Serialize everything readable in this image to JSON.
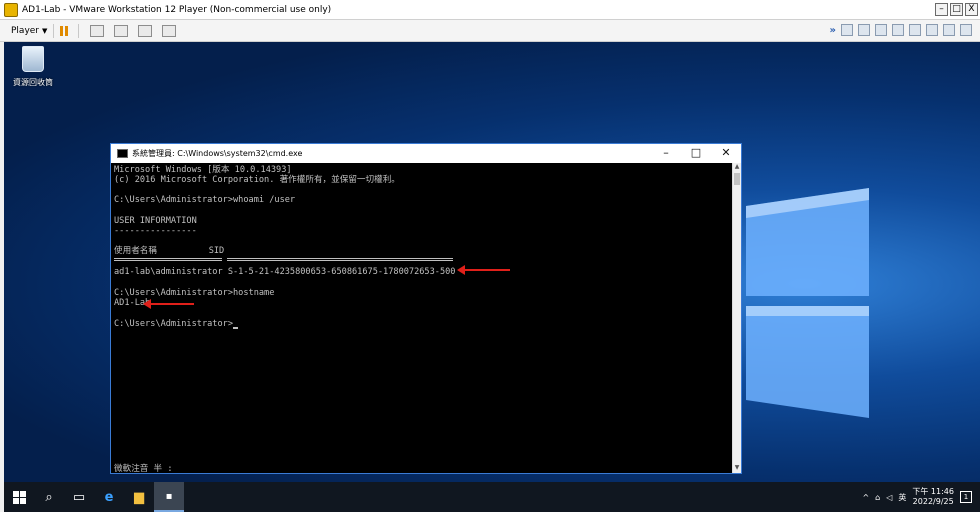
{
  "host": {
    "title": "AD1-Lab - VMware Workstation 12 Player (Non-commercial use only)",
    "player_label": "Player",
    "controls": {
      "minimize": "–",
      "restore": "□",
      "close": "X"
    }
  },
  "desktop": {
    "recycle_bin_label": "資源回收筒"
  },
  "cmd": {
    "title": "系統管理員: C:\\Windows\\system32\\cmd.exe",
    "lines": [
      "Microsoft Windows [版本 10.0.14393]",
      "(c) 2016 Microsoft Corporation. 著作權所有，並保留一切權利。",
      "",
      "C:\\Users\\Administrator>whoami /user",
      "",
      "USER INFORMATION",
      "----------------",
      "",
      "使用者名稱          SID",
      "",
      "ad1-lab\\administrator S-1-5-21-4235800653-650861675-1780072653-500",
      "",
      "C:\\Users\\Administrator>hostname",
      "AD1-Lab",
      "",
      "C:\\Users\\Administrator>"
    ],
    "ime_status": "微軟注音 半 :"
  },
  "taskbar": {
    "time": "下午 11:46",
    "date": "2022/9/25",
    "lang": "英",
    "notification_count": "1"
  },
  "colors": {
    "arrow": "#e0201a",
    "desktop": "#06306e",
    "taskbar": "#101720"
  }
}
